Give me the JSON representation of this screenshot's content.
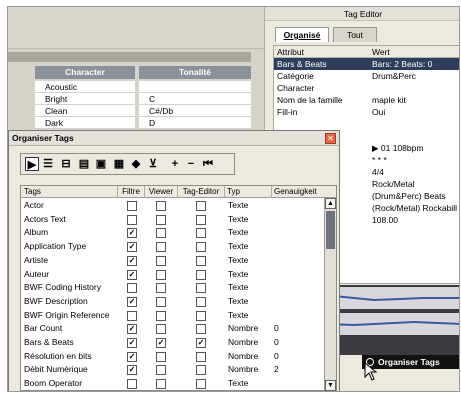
{
  "background_app": {
    "columns": {
      "character": "Character",
      "tonalite": "Tonalité"
    },
    "rows": [
      {
        "character": "Acoustic",
        "tonalite": ""
      },
      {
        "character": "Bright",
        "tonalite": "C"
      },
      {
        "character": "Clean",
        "tonalite": "C#/Db"
      },
      {
        "character": "Dark",
        "tonalite": "D"
      }
    ]
  },
  "tag_editor": {
    "title": "Tag Editor",
    "tabs": [
      "Organisé",
      "Tout"
    ],
    "columns": {
      "attribut": "Attribut",
      "wert": "Wert"
    },
    "rows": [
      {
        "attribut": "Bars & Beats",
        "wert": "Bars: 2 Beats: 0",
        "selected": true
      },
      {
        "attribut": "Catégorie",
        "wert": "Drum&Perc"
      },
      {
        "attribut": "Character",
        "wert": ""
      },
      {
        "attribut": "Nom de la famille",
        "wert": "maple kit"
      },
      {
        "attribut": "Fill-in",
        "wert": "Oui"
      },
      {
        "attribut": "",
        "wert": ""
      },
      {
        "attribut": "",
        "wert": ""
      },
      {
        "attribut": "",
        "wert": "▶ 01 108bpm"
      },
      {
        "attribut": "",
        "wert": "* * *"
      },
      {
        "attribut": "",
        "wert": "4/4"
      },
      {
        "attribut": "",
        "wert": "Rock/Metal"
      },
      {
        "attribut": "",
        "wert": "(Drum&Perc) Beats"
      },
      {
        "attribut": "",
        "wert": "(Rock/Metal) Rockabill"
      },
      {
        "attribut": "",
        "wert": "108.00"
      }
    ],
    "wave_marker": "4",
    "organiser_button": "Organiser Tags"
  },
  "dialog": {
    "title": "Organiser Tags",
    "close_glyph": "✕",
    "toolbar_icons": [
      {
        "name": "select-arrow-icon",
        "glyph": "▶"
      },
      {
        "name": "align-top-icon",
        "glyph": "☰"
      },
      {
        "name": "align-middle-icon",
        "glyph": "⊟"
      },
      {
        "name": "list-icon",
        "glyph": "▤"
      },
      {
        "name": "stack-icon",
        "glyph": "▣"
      },
      {
        "name": "table-icon",
        "glyph": "▦"
      },
      {
        "name": "cube-icon",
        "glyph": "◆"
      },
      {
        "name": "tray-icon",
        "glyph": "⊻"
      },
      {
        "name": "add-icon",
        "glyph": "+"
      },
      {
        "name": "remove-icon",
        "glyph": "−"
      },
      {
        "name": "skip-icon",
        "glyph": "⏮"
      }
    ],
    "columns": {
      "tags": "Tags",
      "filtre": "Filtre",
      "viewer": "Viewer",
      "tag_editor": "Tag-Editor",
      "typ": "Typ",
      "genauigkeit": "Genauigkeit"
    },
    "rows": [
      {
        "tag": "Actor",
        "filtre": false,
        "viewer": false,
        "editor": false,
        "typ": "Texte",
        "genauigkeit": ""
      },
      {
        "tag": "Actors Text",
        "filtre": false,
        "viewer": false,
        "editor": false,
        "typ": "Texte",
        "genauigkeit": ""
      },
      {
        "tag": "Album",
        "filtre": true,
        "viewer": false,
        "editor": false,
        "typ": "Texte",
        "genauigkeit": ""
      },
      {
        "tag": "Application Type",
        "filtre": true,
        "viewer": false,
        "editor": false,
        "typ": "Texte",
        "genauigkeit": ""
      },
      {
        "tag": "Artiste",
        "filtre": true,
        "viewer": false,
        "editor": false,
        "typ": "Texte",
        "genauigkeit": ""
      },
      {
        "tag": "Auteur",
        "filtre": true,
        "viewer": false,
        "editor": false,
        "typ": "Texte",
        "genauigkeit": ""
      },
      {
        "tag": "BWF Coding History",
        "filtre": false,
        "viewer": false,
        "editor": false,
        "typ": "Texte",
        "genauigkeit": ""
      },
      {
        "tag": "BWF Description",
        "filtre": true,
        "viewer": false,
        "editor": false,
        "typ": "Texte",
        "genauigkeit": ""
      },
      {
        "tag": "BWF Origin Reference",
        "filtre": false,
        "viewer": false,
        "editor": false,
        "typ": "Texte",
        "genauigkeit": ""
      },
      {
        "tag": "Bar Count",
        "filtre": true,
        "viewer": false,
        "editor": false,
        "typ": "Nombre",
        "genauigkeit": "0"
      },
      {
        "tag": "Bars & Beats",
        "filtre": true,
        "viewer": true,
        "editor": true,
        "typ": "Nombre",
        "genauigkeit": "0"
      },
      {
        "tag": "Résolution en bits",
        "filtre": true,
        "viewer": false,
        "editor": false,
        "typ": "Nombre",
        "genauigkeit": "0"
      },
      {
        "tag": "Débit Numérique",
        "filtre": true,
        "viewer": false,
        "editor": false,
        "typ": "Nombre",
        "genauigkeit": "2"
      },
      {
        "tag": "Boom Operator",
        "filtre": false,
        "viewer": false,
        "editor": false,
        "typ": "Texte",
        "genauigkeit": ""
      }
    ]
  }
}
